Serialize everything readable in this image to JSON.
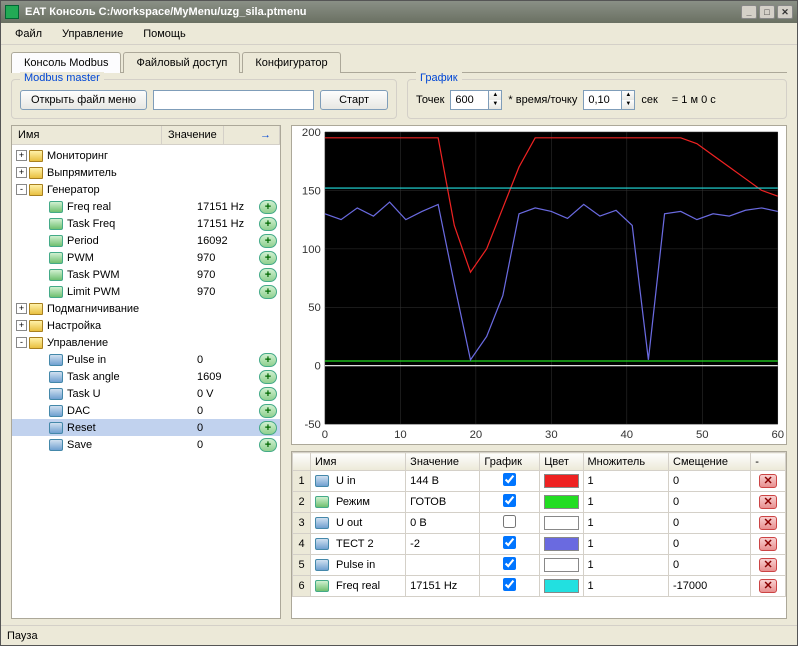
{
  "title": "EAT Консоль   C:/workspace/MyMenu/uzg_sila.ptmenu",
  "menu": [
    "Файл",
    "Управление",
    "Помощь"
  ],
  "tabs": [
    "Консоль Modbus",
    "Файловый доступ",
    "Конфигуратор"
  ],
  "active_tab": 0,
  "modbus_master": {
    "legend": "Modbus master",
    "open_btn": "Открыть файл меню",
    "file_value": "",
    "start_btn": "Старт"
  },
  "graph_box": {
    "legend": "График",
    "points_label": "Точек",
    "points_value": "600",
    "time_label": "* время/точку",
    "time_value": "0,10",
    "sec_label": "сек",
    "total_label": "= 1 м 0 с"
  },
  "tree": {
    "header_name": "Имя",
    "header_value": "Значение",
    "nodes": [
      {
        "type": "folder",
        "level": 0,
        "expand": "+",
        "name": "Мониторинг"
      },
      {
        "type": "folder",
        "level": 0,
        "expand": "+",
        "name": "Выпрямитель"
      },
      {
        "type": "folder",
        "level": 0,
        "expand": "-",
        "name": "Генератор"
      },
      {
        "type": "param",
        "level": 1,
        "name": "Freq real",
        "value": "17151 Hz",
        "add": true
      },
      {
        "type": "param",
        "level": 1,
        "name": "Task Freq",
        "value": "17151 Hz",
        "add": true
      },
      {
        "type": "param",
        "level": 1,
        "name": "Period",
        "value": "16092",
        "add": true
      },
      {
        "type": "param",
        "level": 1,
        "name": "PWM",
        "value": "970",
        "add": true
      },
      {
        "type": "param",
        "level": 1,
        "name": "Task PWM",
        "value": "970",
        "add": true
      },
      {
        "type": "param",
        "level": 1,
        "name": "Limit PWM",
        "value": "970",
        "add": true
      },
      {
        "type": "folder",
        "level": 0,
        "expand": "+",
        "name": "Подмагничивание"
      },
      {
        "type": "folder",
        "level": 0,
        "expand": "+",
        "name": "Настройка"
      },
      {
        "type": "folder",
        "level": 0,
        "expand": "-",
        "name": "Управление"
      },
      {
        "type": "param",
        "level": 1,
        "icon": "blue",
        "name": "Pulse in",
        "value": "0",
        "add": true
      },
      {
        "type": "param",
        "level": 1,
        "icon": "blue",
        "name": "Task angle",
        "value": "1609",
        "add": true
      },
      {
        "type": "param",
        "level": 1,
        "icon": "blue",
        "name": "Task U",
        "value": "0 V",
        "add": true
      },
      {
        "type": "param",
        "level": 1,
        "icon": "blue",
        "name": "DAC",
        "value": "0",
        "add": true
      },
      {
        "type": "param",
        "level": 1,
        "icon": "blue",
        "name": "Reset",
        "value": "0",
        "add": true,
        "selected": true
      },
      {
        "type": "param",
        "level": 1,
        "icon": "blue",
        "name": "Save",
        "value": "0",
        "add": true
      }
    ]
  },
  "chart_data": {
    "type": "line",
    "xlim": [
      0,
      60
    ],
    "ylim": [
      -50,
      200
    ],
    "xticks": [
      0,
      10,
      20,
      30,
      40,
      50,
      60
    ],
    "yticks": [
      -50,
      0,
      50,
      100,
      150,
      200
    ],
    "series": [
      {
        "name": "U in",
        "color": "#ee2222",
        "y_approx": [
          195,
          195,
          195,
          195,
          195,
          195,
          195,
          195,
          120,
          80,
          100,
          135,
          170,
          195,
          195,
          195,
          195,
          195,
          195,
          195,
          195,
          195,
          195,
          190,
          180,
          170,
          160,
          150,
          145
        ]
      },
      {
        "name": "Режим",
        "color": "#22dd22",
        "y_approx": [
          4,
          4,
          4,
          4,
          4,
          4,
          4,
          4,
          4,
          4,
          4,
          4,
          4,
          4,
          4,
          4,
          4,
          4,
          4,
          4,
          4,
          4,
          4,
          4,
          4,
          4,
          4,
          4,
          4
        ]
      },
      {
        "name": "ТЕСТ 2",
        "color": "#6a6ae0",
        "y_approx": [
          130,
          125,
          135,
          128,
          140,
          125,
          132,
          138,
          70,
          5,
          25,
          60,
          130,
          135,
          132,
          126,
          138,
          128,
          133,
          120,
          5,
          130,
          132,
          125,
          130,
          128,
          133,
          135,
          132
        ]
      },
      {
        "name": "Pulse in",
        "color": "#ffffff",
        "y_approx": [
          0,
          0,
          0,
          0,
          0,
          0,
          0,
          0,
          0,
          0,
          0,
          0,
          0,
          0,
          0,
          0,
          0,
          0,
          0,
          0,
          0,
          0,
          0,
          0,
          0,
          0,
          0,
          0,
          0
        ]
      },
      {
        "name": "Freq real",
        "color": "#22e0e0",
        "y_approx": [
          152,
          152,
          152,
          152,
          152,
          152,
          152,
          152,
          152,
          152,
          152,
          152,
          152,
          152,
          152,
          152,
          152,
          152,
          152,
          152,
          152,
          152,
          152,
          152,
          152,
          152,
          152,
          152,
          152
        ]
      }
    ]
  },
  "grid": {
    "headers": [
      "",
      "Имя",
      "Значение",
      "График",
      "Цвет",
      "Множитель",
      "Смещение",
      "-"
    ],
    "rows": [
      {
        "n": "1",
        "icon": "blue",
        "name": "U in",
        "value": "144 В",
        "plot": true,
        "color": "#ee2222",
        "mult": "1",
        "offset": "0"
      },
      {
        "n": "2",
        "icon": "org",
        "name": "Режим",
        "value": "ГОТОВ",
        "plot": true,
        "color": "#22dd22",
        "mult": "1",
        "offset": "0"
      },
      {
        "n": "3",
        "icon": "blue",
        "name": "U out",
        "value": "0 В",
        "plot": false,
        "color": "#ffffff",
        "mult": "1",
        "offset": "0"
      },
      {
        "n": "4",
        "icon": "blue",
        "name": "ТЕСТ 2",
        "value": "-2",
        "plot": true,
        "color": "#6a6ae0",
        "mult": "1",
        "offset": "0"
      },
      {
        "n": "5",
        "icon": "blue",
        "name": "Pulse in",
        "value": "",
        "plot": true,
        "color": "#ffffff",
        "mult": "1",
        "offset": "0"
      },
      {
        "n": "6",
        "icon": "green",
        "name": "Freq real",
        "value": "17151 Hz",
        "plot": true,
        "color": "#22e0e0",
        "mult": "1",
        "offset": "-17000"
      }
    ]
  },
  "status": "Пауза"
}
